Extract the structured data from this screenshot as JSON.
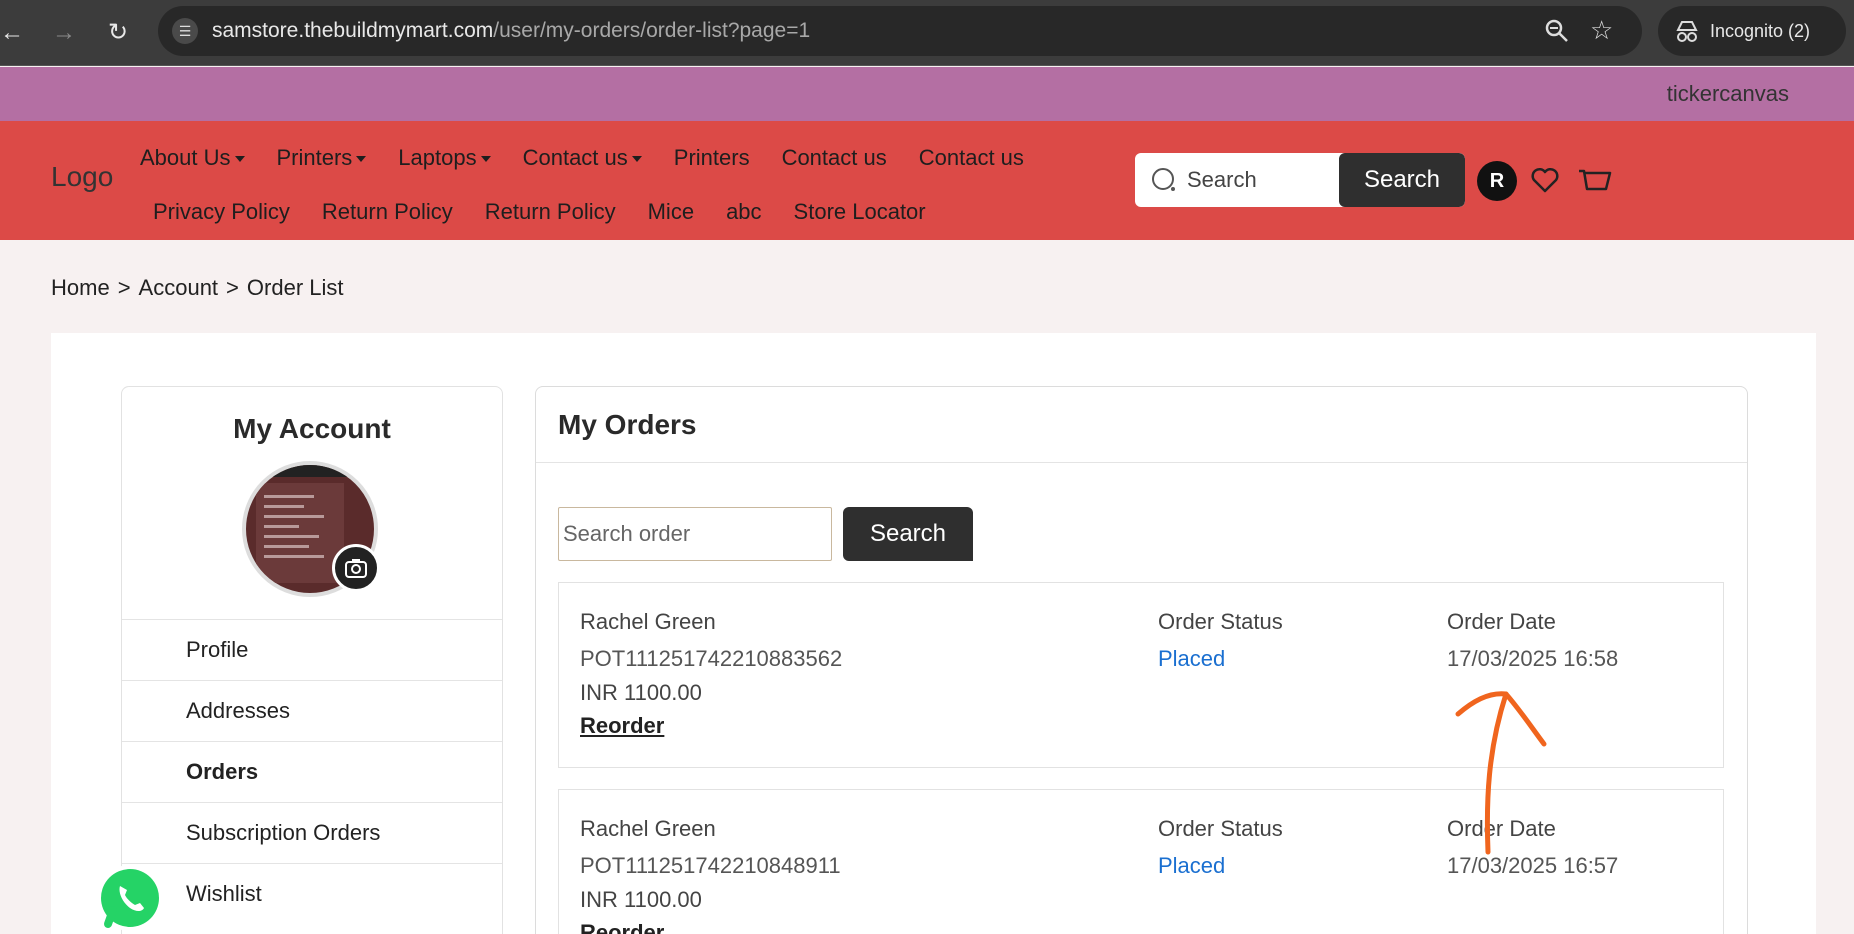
{
  "browser": {
    "url_host": "samstore.thebuildmymart.com",
    "url_path": "/user/my-orders/order-list?page=1",
    "incognito_label": "Incognito (2)"
  },
  "ticker": {
    "text": "tickercanvas"
  },
  "header": {
    "logo": "Logo",
    "nav_row1": [
      {
        "label": "About Us",
        "dropdown": true
      },
      {
        "label": "Printers",
        "dropdown": true
      },
      {
        "label": "Laptops",
        "dropdown": true
      },
      {
        "label": "Contact us",
        "dropdown": true
      },
      {
        "label": "Printers",
        "dropdown": false
      },
      {
        "label": "Contact us",
        "dropdown": false
      },
      {
        "label": "Contact us",
        "dropdown": false
      }
    ],
    "nav_row2": [
      "Privacy Policy",
      "Return Policy",
      "Return Policy",
      "Mice",
      "abc",
      "Store Locator"
    ],
    "search_placeholder": "Search",
    "search_button": "Search",
    "user_initial": "R"
  },
  "breadcrumb": [
    "Home",
    "Account",
    "Order List"
  ],
  "sidebar": {
    "title": "My Account",
    "items": [
      {
        "label": "Profile",
        "active": false
      },
      {
        "label": "Addresses",
        "active": false
      },
      {
        "label": "Orders",
        "active": true
      },
      {
        "label": "Subscription Orders",
        "active": false
      },
      {
        "label": "Wishlist",
        "active": false
      }
    ]
  },
  "orders": {
    "title": "My Orders",
    "search_placeholder": "Search order",
    "search_button": "Search",
    "list": [
      {
        "name": "Rachel Green",
        "id": "POT111251742210883562",
        "amount": "INR 1100.00",
        "reorder": "Reorder",
        "status_label": "Order Status",
        "status": "Placed",
        "date_label": "Order Date",
        "date": "17/03/2025 16:58"
      },
      {
        "name": "Rachel Green",
        "id": "POT111251742210848911",
        "amount": "INR 1100.00",
        "reorder": "Reorder",
        "status_label": "Order Status",
        "status": "Placed",
        "date_label": "Order Date",
        "date": "17/03/2025 16:57"
      }
    ]
  },
  "colors": {
    "ticker_bg": "#b46fa3",
    "header_bg": "#dc4a47",
    "status_placed": "#1a6fd0",
    "annotation": "#f0651e"
  }
}
